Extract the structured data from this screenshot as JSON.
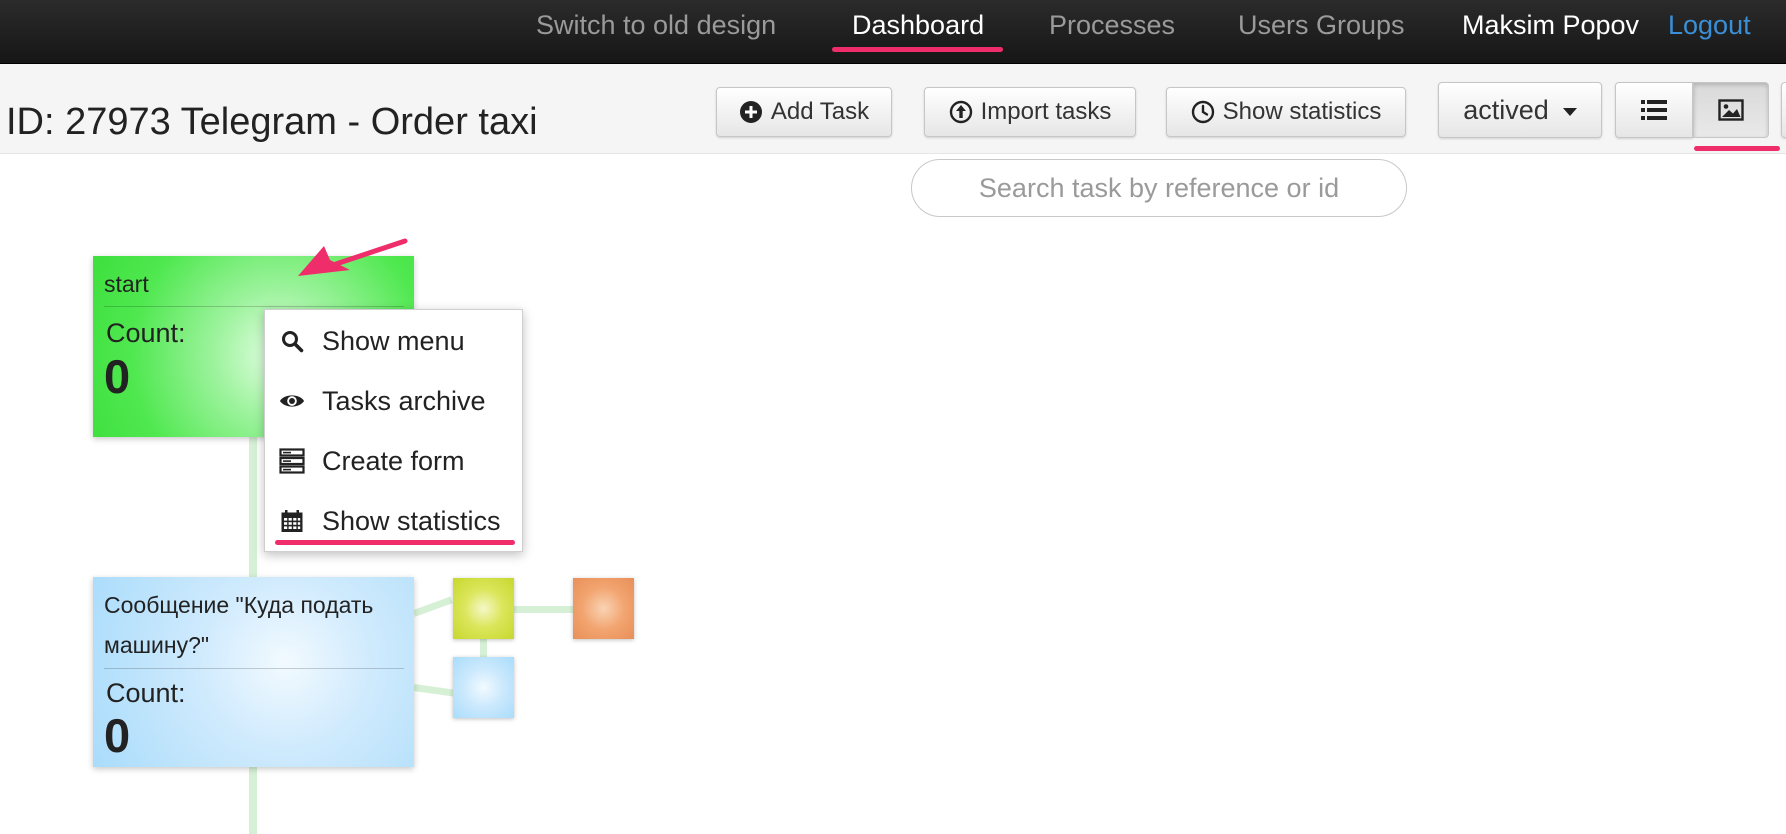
{
  "navbar": {
    "links": [
      "Switch to old design",
      "Dashboard",
      "Processes",
      "Users Groups"
    ],
    "active": "Dashboard",
    "user": "Maksim Popov",
    "logout": "Logout"
  },
  "header": {
    "title": "ID: 27973 Telegram - Order taxi",
    "buttons": {
      "add_task": "Add Task",
      "import_tasks": "Import tasks",
      "show_statistics": "Show statistics"
    },
    "status_dropdown": "actived",
    "view_toggle": {
      "active": "image-view"
    }
  },
  "search": {
    "placeholder": "Search task by reference or id"
  },
  "graph": {
    "nodes": [
      {
        "title": "start",
        "count_label": "Count:",
        "count": "0",
        "color": "#3edf3e"
      },
      {
        "title": "Сообщение \"Куда подать машину?\"",
        "count_label": "Count:",
        "count": "0",
        "color": "#a9dcfb"
      }
    ],
    "mini_nodes": [
      {
        "color": "#c7d72e"
      },
      {
        "color": "#e88f59"
      },
      {
        "color": "#a9dcfb"
      }
    ]
  },
  "context_menu": {
    "items": [
      {
        "label": "Show menu",
        "icon": "search-icon"
      },
      {
        "label": "Tasks archive",
        "icon": "eye-icon"
      },
      {
        "label": "Create form",
        "icon": "form-icon"
      },
      {
        "label": "Show statistics",
        "icon": "calendar-icon"
      }
    ]
  },
  "colors": {
    "highlight": "#ef2d6a",
    "link": "#3b8fd6",
    "navbar_bg": "#1e1e1e"
  }
}
